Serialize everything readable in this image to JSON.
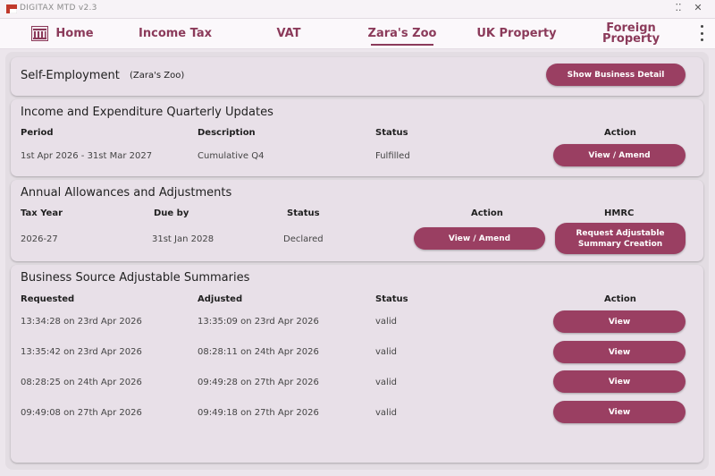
{
  "window": {
    "title": "DIGITAX MTD v2.3"
  },
  "nav": {
    "tabs": [
      {
        "label": "Home"
      },
      {
        "label": "Income Tax"
      },
      {
        "label": "VAT"
      },
      {
        "label": "Zara's Zoo"
      },
      {
        "label": "UK Property"
      },
      {
        "label": "Foreign Property"
      }
    ],
    "active": "Zara's Zoo"
  },
  "self_employment": {
    "title": "Self-Employment",
    "business_name": "(Zara's Zoo)",
    "detail_button": "Show Business Detail"
  },
  "quarterly": {
    "title": "Income and Expenditure Quarterly Updates",
    "headers": {
      "period": "Period",
      "description": "Description",
      "status": "Status",
      "action": "Action"
    },
    "row": {
      "period": "1st Apr 2026 - 31st Mar 2027",
      "description": "Cumulative Q4",
      "status": "Fulfilled",
      "action_label": "View / Amend"
    }
  },
  "annual": {
    "title": "Annual Allowances and Adjustments",
    "headers": {
      "tax_year": "Tax Year",
      "due_by": "Due by",
      "status": "Status",
      "action": "Action",
      "hmrc": "HMRC"
    },
    "row": {
      "tax_year": "2026-27",
      "due_by": "31st Jan 2028",
      "status": "Declared",
      "action_label": "View / Amend",
      "hmrc_label_1": "Request Adjustable",
      "hmrc_label_2": "Summary Creation"
    }
  },
  "summaries": {
    "title": "Business Source Adjustable Summaries",
    "headers": {
      "requested": "Requested",
      "adjusted": "Adjusted",
      "status": "Status",
      "action": "Action"
    },
    "rows": [
      {
        "requested": "13:34:28 on 23rd Apr 2026",
        "adjusted": "13:35:09 on 23rd Apr 2026",
        "status": "valid",
        "action_label": "View"
      },
      {
        "requested": "13:35:42 on 23rd Apr 2026",
        "adjusted": "08:28:11 on 24th Apr 2026",
        "status": "valid",
        "action_label": "View"
      },
      {
        "requested": "08:28:25 on 24th Apr 2026",
        "adjusted": "09:49:28 on 27th Apr 2026",
        "status": "valid",
        "action_label": "View"
      },
      {
        "requested": "09:49:08 on 27th Apr 2026",
        "adjusted": "09:49:18 on 27th Apr 2026",
        "status": "valid",
        "action_label": "View"
      }
    ]
  },
  "colors": {
    "accent": "#8b3a5a",
    "button": "#9a3f62",
    "card": "#e8e0e8",
    "background": "#ece6ec"
  },
  "icons": {
    "app": "flag-icon",
    "home": "building-icon",
    "menu": "kebab-menu-icon"
  }
}
